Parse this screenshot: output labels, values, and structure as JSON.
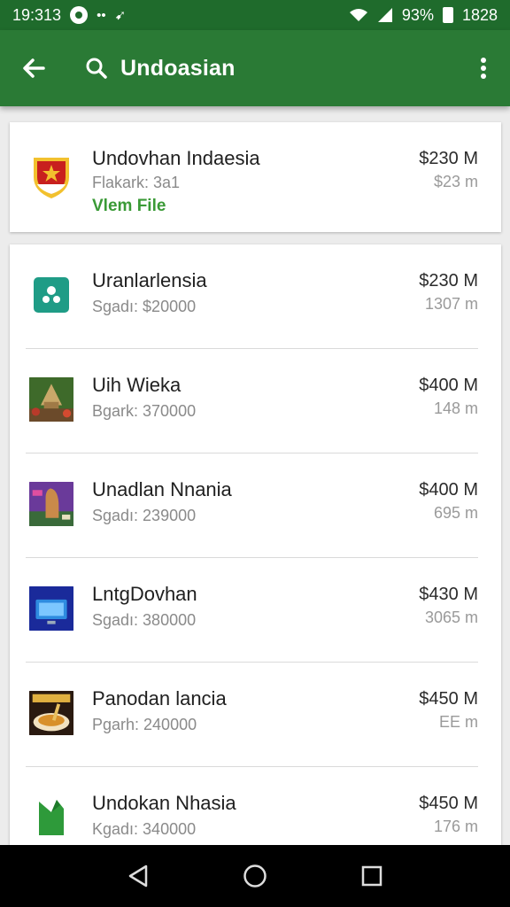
{
  "status_bar": {
    "time": "19:313",
    "battery": "93%",
    "clock_right": "1828",
    "icons": [
      "circle-icon",
      "dots-icon",
      "location-icon",
      "wifi-icon",
      "signal-icon",
      "battery-icon"
    ]
  },
  "app_bar": {
    "title": "Undoasian",
    "icons": [
      "back-arrow-icon",
      "search-icon",
      "more-vert-icon"
    ]
  },
  "top_card": {
    "title": "Undovhan Indaesia",
    "subtitle": "Flakark: 3a1",
    "link": "Vlem File",
    "price": "$230 M",
    "meta": "$23 m",
    "icon": "shield-star-icon",
    "colors": {
      "link": "#3a9a36",
      "shield_red": "#c8201e",
      "shield_gold": "#f2c12e"
    }
  },
  "list": [
    {
      "title": "Uranlarlensia",
      "subtitle": "Sgadı: $20000",
      "price": "$230 M",
      "meta": "1307 m",
      "icon": "teal-app-icon"
    },
    {
      "title": "Uih Wieka",
      "subtitle": "Bgark: 370000",
      "price": "$400 M",
      "meta": "148 m",
      "icon": "temple-photo-icon"
    },
    {
      "title": "Unadlan Nnania",
      "subtitle": "Sgadı: 239000",
      "price": "$400 M",
      "meta": "695 m",
      "icon": "monument-purple-icon"
    },
    {
      "title": "LntgDovhan",
      "subtitle": "Sgadı: 380000",
      "price": "$430 M",
      "meta": "3065 m",
      "icon": "monitor-blue-icon"
    },
    {
      "title": "Panodan lancia",
      "subtitle": "Pgarh: 240000",
      "price": "$450 M",
      "meta": "EE m",
      "icon": "food-bowl-icon"
    },
    {
      "title": "Undokan Nhasia",
      "subtitle": "Kgadı: 340000",
      "price": "$450 M",
      "meta": "176 m",
      "icon": "green-leaf-icon"
    }
  ],
  "nav_bar": {
    "icons": [
      "back-triangle-icon",
      "home-circle-icon",
      "recents-square-icon"
    ]
  },
  "colors": {
    "status_bar": "#1f6b2c",
    "app_bar": "#2a7a35",
    "background": "#ececec"
  }
}
